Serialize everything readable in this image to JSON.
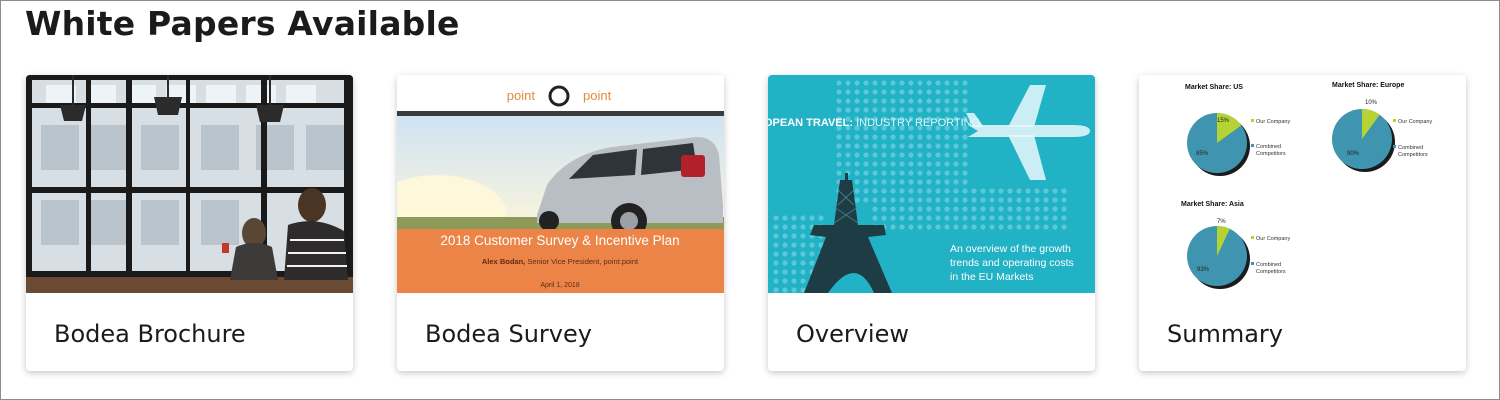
{
  "section": {
    "title": "White Papers Available"
  },
  "cards": [
    {
      "title": "Bodea Brochure",
      "thumbnail_icon": "office-photo"
    },
    {
      "title": "Bodea Survey",
      "thumbnail_icon": "car-cover",
      "thumb": {
        "logo_left": "point",
        "logo_right": "point",
        "headline": "2018 Customer Survey & Incentive Plan",
        "byline_name": "Alex Bodan,",
        "byline_role": " Senior Vice President, point:point",
        "date": "April 1, 2018",
        "banner_color": "#ec8447"
      }
    },
    {
      "title": "Overview",
      "thumbnail_icon": "travel-cover",
      "thumb": {
        "heading_bold": "OPEAN TRAVEL:",
        "heading_light": " INDUSTRY REPORTING",
        "blurb_line1": "An overview of the growth",
        "blurb_line2": "trends and operating costs",
        "blurb_line3": "in the EU Markets",
        "background_color": "#21b2c6"
      }
    },
    {
      "title": "Summary",
      "thumbnail_icon": "pie-charts",
      "thumb": {
        "pies": [
          {
            "title": "Market Share: US",
            "company_pct": "15%",
            "competitors_pct": "85%",
            "company_share": 0.15
          },
          {
            "title": "Market Share: Europe",
            "company_pct": "10%",
            "competitors_pct": "90%",
            "company_share": 0.1
          },
          {
            "title": "Market Share: Asia",
            "company_pct": "7%",
            "competitors_pct": "93%",
            "company_share": 0.07
          }
        ],
        "legend_company": "Our Company",
        "legend_competitors_line1": "Combined",
        "legend_competitors_line2": "Competitors",
        "company_color": "#b5d334",
        "competitors_color": "#3f95b0"
      }
    }
  ]
}
